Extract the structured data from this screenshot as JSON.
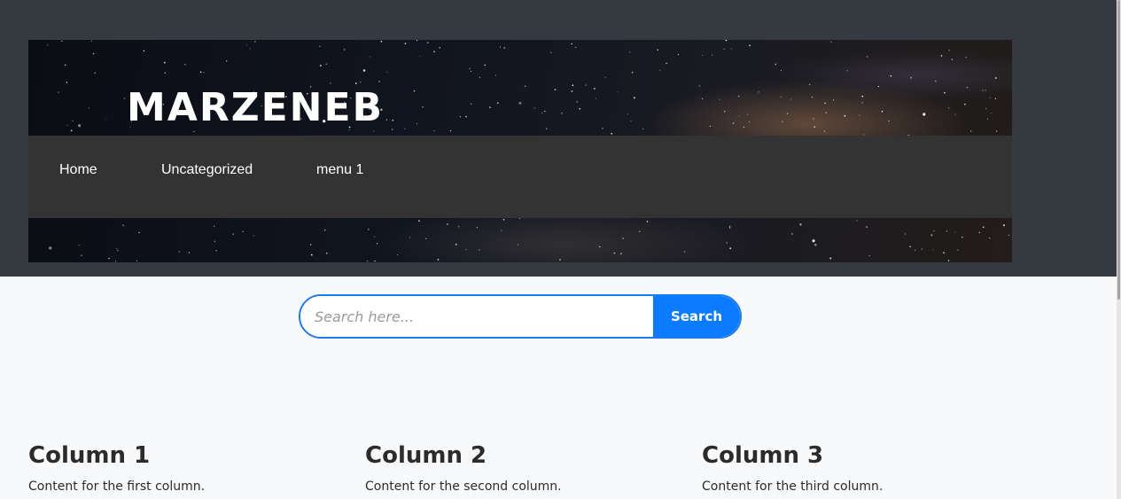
{
  "header": {
    "site_title": "MARZENEB"
  },
  "nav": {
    "items": [
      {
        "label": "Home"
      },
      {
        "label": "Uncategorized"
      },
      {
        "label": "menu 1"
      }
    ]
  },
  "search": {
    "placeholder": "Search here...",
    "value": "",
    "button_label": "Search"
  },
  "columns": [
    {
      "title": "Column 1",
      "text": "Content for the first column."
    },
    {
      "title": "Column 2",
      "text": "Content for the second column."
    },
    {
      "title": "Column 3",
      "text": "Content for the third column."
    }
  ],
  "colors": {
    "page_background": "#f8f9fa",
    "top_band": "#343a40",
    "navbar": "#333333",
    "accent": "#0b7bff"
  }
}
